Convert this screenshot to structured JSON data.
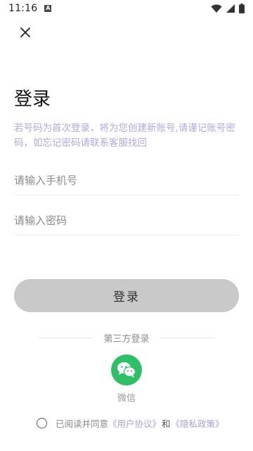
{
  "status_bar": {
    "time": "11:16",
    "notification_badge": "A"
  },
  "header": {
    "close_icon": "close-icon"
  },
  "login": {
    "title": "登录",
    "notice": "若号码为首次登录，将为您创建新账号,请谨记账号密码，如忘记密码请联系客服找回",
    "phone_placeholder": "请输入手机号",
    "password_placeholder": "请输入密码",
    "submit_label": "登录"
  },
  "third_party": {
    "label": "第三方登录",
    "wechat_label": "微信"
  },
  "agreement": {
    "prefix": "已阅读并同意",
    "user_agreement": "《用户协议》",
    "and": "和",
    "privacy_policy": "《隐私政策》"
  },
  "colors": {
    "notice": "#b3a7e6",
    "button_bg": "#c9c9c9",
    "wechat_green": "#2ec066",
    "link": "#a7a0de"
  }
}
